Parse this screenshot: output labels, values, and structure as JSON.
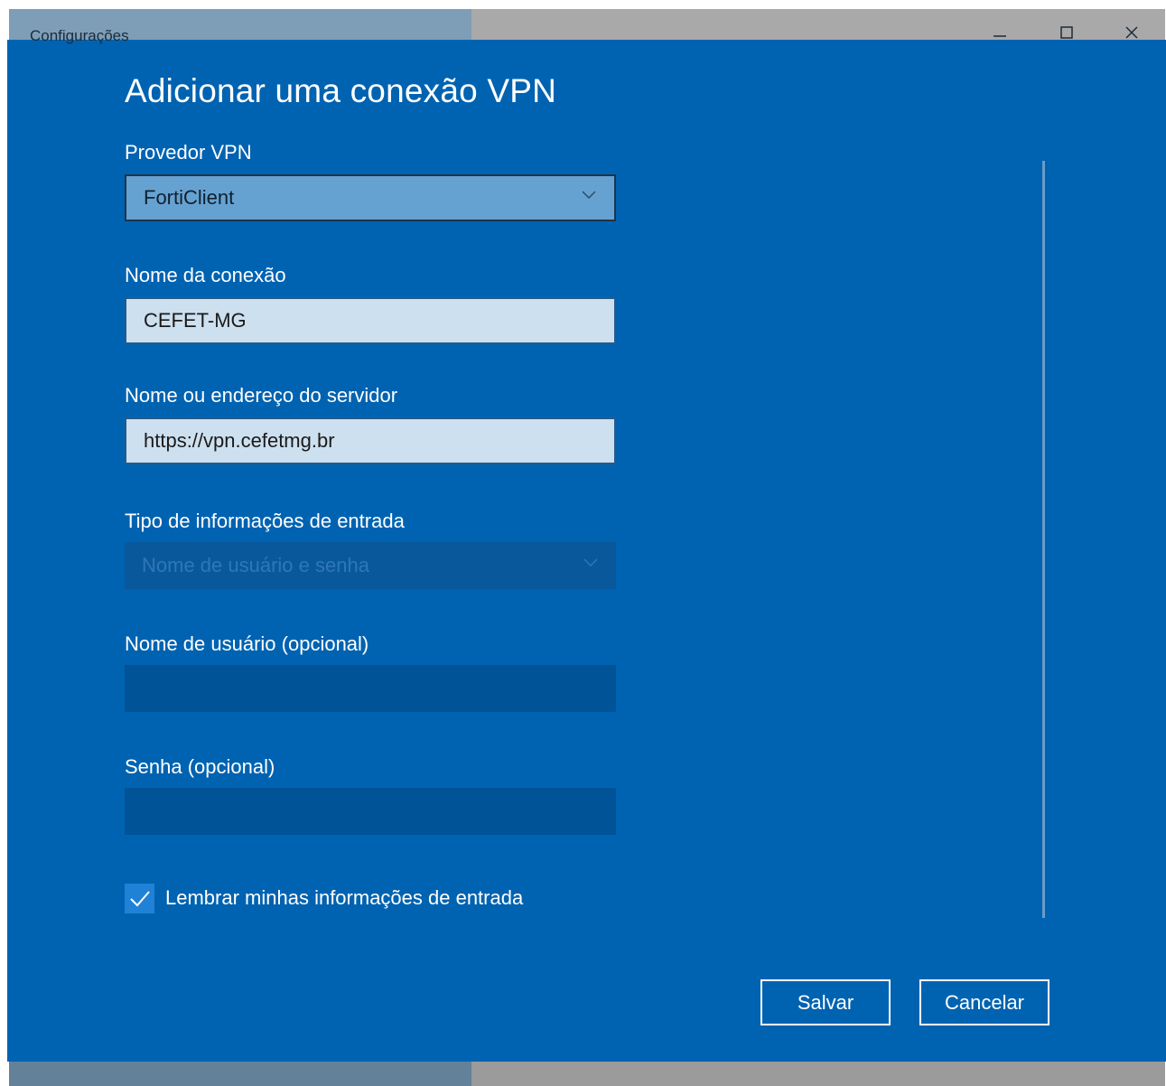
{
  "window": {
    "title": "Configurações",
    "minimize_glyph": "—",
    "maximize_glyph": "☐",
    "close_glyph": "✕"
  },
  "dialog": {
    "heading": "Adicionar uma conexão VPN",
    "vpn_provider": {
      "label": "Provedor VPN",
      "value": "FortiClient"
    },
    "connection_name": {
      "label": "Nome da conexão",
      "value": "CEFET-MG"
    },
    "server_address": {
      "label": "Nome ou endereço do servidor",
      "value": "https://vpn.cefetmg.br"
    },
    "sign_in_type": {
      "label": "Tipo de informações de entrada",
      "value": "Nome de usuário e senha"
    },
    "username": {
      "label": "Nome de usuário (opcional)",
      "value": ""
    },
    "password": {
      "label": "Senha (opcional)",
      "value": ""
    },
    "remember": {
      "label": "Lembrar minhas informações de entrada",
      "checked": true
    },
    "buttons": {
      "save": "Salvar",
      "cancel": "Cancelar"
    }
  },
  "colors": {
    "dialog_bg": "#0063b1",
    "accent": "#1f82d6"
  },
  "icons": {
    "dropdown": "chevron-down-icon",
    "checkbox": "checkmark-icon"
  }
}
